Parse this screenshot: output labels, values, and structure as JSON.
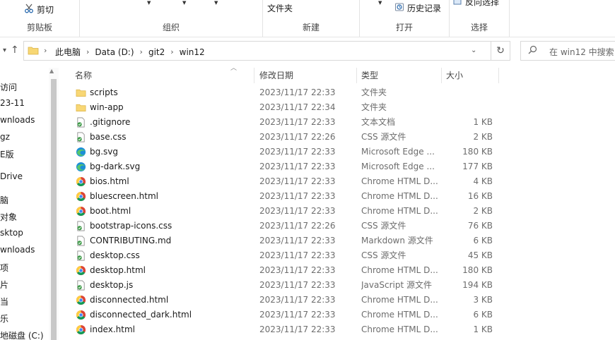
{
  "ribbon": {
    "clipboard": {
      "cut_label": "剪切",
      "group_label": "剪贴板"
    },
    "organize": {
      "group_label": "组织"
    },
    "new": {
      "new_folder_label": "文件夹",
      "group_label": "新建"
    },
    "open": {
      "history_label": "历史记录",
      "group_label": "打开"
    },
    "select": {
      "invert_label": "反向选择",
      "group_label": "选择"
    }
  },
  "address": {
    "crumbs": [
      "此电脑",
      "Data (D:)",
      "git2",
      "win12"
    ]
  },
  "search": {
    "placeholder": "在 win12 中搜索"
  },
  "nav": {
    "items": [
      "访问",
      "23-11",
      "wnloads",
      "gz",
      "E版",
      "Drive",
      "脑",
      "对象",
      "sktop",
      "wnloads",
      "项",
      "片",
      "当",
      "乐",
      "地磁盘 (C:)"
    ]
  },
  "columns": {
    "name": "名称",
    "date": "修改日期",
    "type": "类型",
    "size": "大小"
  },
  "files": [
    {
      "name": "scripts",
      "date": "2023/11/17 22:33",
      "type": "文件夹",
      "size": "",
      "icon": "folder-icon"
    },
    {
      "name": "win-app",
      "date": "2023/11/17 22:34",
      "type": "文件夹",
      "size": "",
      "icon": "folder-icon"
    },
    {
      "name": ".gitignore",
      "date": "2023/11/17 22:33",
      "type": "文本文档",
      "size": "1 KB",
      "icon": "text-file-icon"
    },
    {
      "name": "base.css",
      "date": "2023/11/17 22:26",
      "type": "CSS 源文件",
      "size": "2 KB",
      "icon": "text-file-icon"
    },
    {
      "name": "bg.svg",
      "date": "2023/11/17 22:33",
      "type": "Microsoft Edge ...",
      "size": "180 KB",
      "icon": "edge-icon"
    },
    {
      "name": "bg-dark.svg",
      "date": "2023/11/17 22:33",
      "type": "Microsoft Edge ...",
      "size": "177 KB",
      "icon": "edge-icon"
    },
    {
      "name": "bios.html",
      "date": "2023/11/17 22:33",
      "type": "Chrome HTML D...",
      "size": "4 KB",
      "icon": "chrome-icon"
    },
    {
      "name": "bluescreen.html",
      "date": "2023/11/17 22:33",
      "type": "Chrome HTML D...",
      "size": "16 KB",
      "icon": "chrome-icon"
    },
    {
      "name": "boot.html",
      "date": "2023/11/17 22:33",
      "type": "Chrome HTML D...",
      "size": "2 KB",
      "icon": "chrome-icon"
    },
    {
      "name": "bootstrap-icons.css",
      "date": "2023/11/17 22:26",
      "type": "CSS 源文件",
      "size": "76 KB",
      "icon": "text-file-icon"
    },
    {
      "name": "CONTRIBUTING.md",
      "date": "2023/11/17 22:33",
      "type": "Markdown 源文件",
      "size": "6 KB",
      "icon": "text-file-icon"
    },
    {
      "name": "desktop.css",
      "date": "2023/11/17 22:33",
      "type": "CSS 源文件",
      "size": "45 KB",
      "icon": "text-file-icon"
    },
    {
      "name": "desktop.html",
      "date": "2023/11/17 22:33",
      "type": "Chrome HTML D...",
      "size": "180 KB",
      "icon": "chrome-icon"
    },
    {
      "name": "desktop.js",
      "date": "2023/11/17 22:33",
      "type": "JavaScript 源文件",
      "size": "194 KB",
      "icon": "text-file-icon"
    },
    {
      "name": "disconnected.html",
      "date": "2023/11/17 22:33",
      "type": "Chrome HTML D...",
      "size": "3 KB",
      "icon": "chrome-icon"
    },
    {
      "name": "disconnected_dark.html",
      "date": "2023/11/17 22:33",
      "type": "Chrome HTML D...",
      "size": "6 KB",
      "icon": "chrome-icon"
    },
    {
      "name": "index.html",
      "date": "2023/11/17 22:33",
      "type": "Chrome HTML D...",
      "size": "1 KB",
      "icon": "chrome-icon"
    }
  ]
}
